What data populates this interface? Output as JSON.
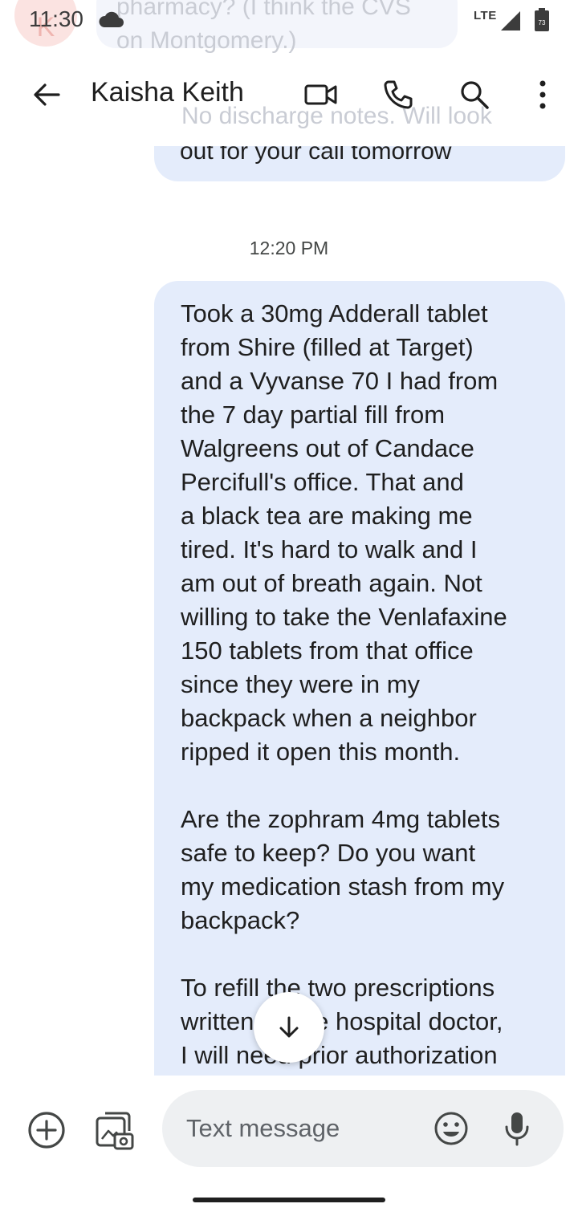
{
  "status_bar": {
    "time": "11:30",
    "network": "LTE",
    "battery": "73",
    "icons": [
      "cloud-icon",
      "signal-icon",
      "battery-icon"
    ]
  },
  "background_ghost": {
    "avatar_letter": "K",
    "text": "pharmacy? (I think the CVS\non Montgomery.)"
  },
  "app_bar": {
    "contact_name": "Kaisha Keith",
    "icons": [
      "back-arrow-icon",
      "video-call-icon",
      "phone-icon",
      "search-icon",
      "more-vert-icon"
    ]
  },
  "conversation": {
    "previous_message": {
      "faded_line": "No discharge notes. Will look",
      "visible_line": "out for your call tomorrow"
    },
    "timestamp": "12:20 PM",
    "message": {
      "text": "Took a 30mg Adderall tablet\nfrom Shire (filled at Target)\nand a Vyvanse 70 I had from\nthe 7 day partial fill from\nWalgreens out of Candace\nPercifull's office. That and\na black tea are making me\ntired. It's hard to walk and I\nam out of breath again. Not\nwilling to take the Venlafaxine\n150 tablets from that office\nsince they were in my\nbackpack when a neighbor\nripped it open this month.\n\nAre the zophram 4mg tablets\nsafe to keep? Do you want\nmy medication stash from my\nbackpack?\n\nTo refill the two prescriptions\nwritten by the hospital doctor,\nI will need prior authorization\npaperwork to get reasonable"
    }
  },
  "compose": {
    "placeholder": "Text message",
    "icons": [
      "add-circle-icon",
      "gallery-icon",
      "emoji-icon",
      "mic-icon"
    ]
  },
  "colors": {
    "bubble": "#e4ecfb",
    "field": "#eef0f2",
    "text": "#1f1f1f"
  }
}
